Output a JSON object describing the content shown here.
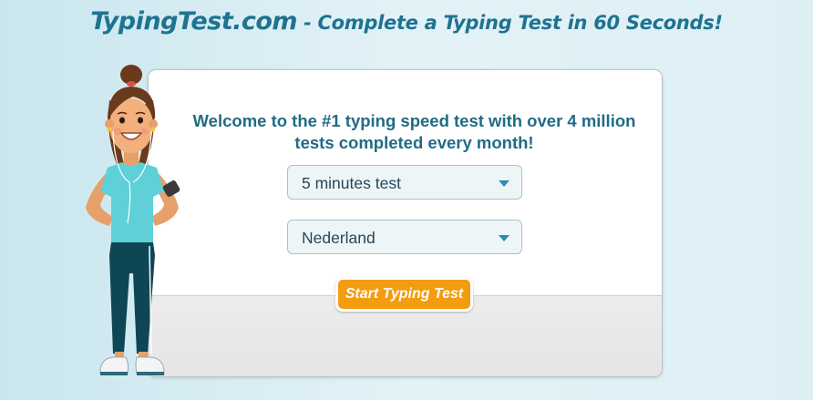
{
  "header": {
    "brand": "TypingTest.com",
    "tagline": " - Complete a Typing Test in 60 Seconds!"
  },
  "card": {
    "welcome_line1": "Welcome to the #1 typing speed test with over 4 million",
    "welcome_line2": "tests completed every month!",
    "duration_select": {
      "value": "5 minutes test",
      "icon": "chevron-down-icon"
    },
    "language_select": {
      "value": "Nederland",
      "icon": "chevron-down-icon"
    },
    "start_button": "Start Typing Test"
  },
  "colors": {
    "accent": "#1e7391",
    "button": "#f49c10",
    "select_bg": "#eef5f7"
  }
}
